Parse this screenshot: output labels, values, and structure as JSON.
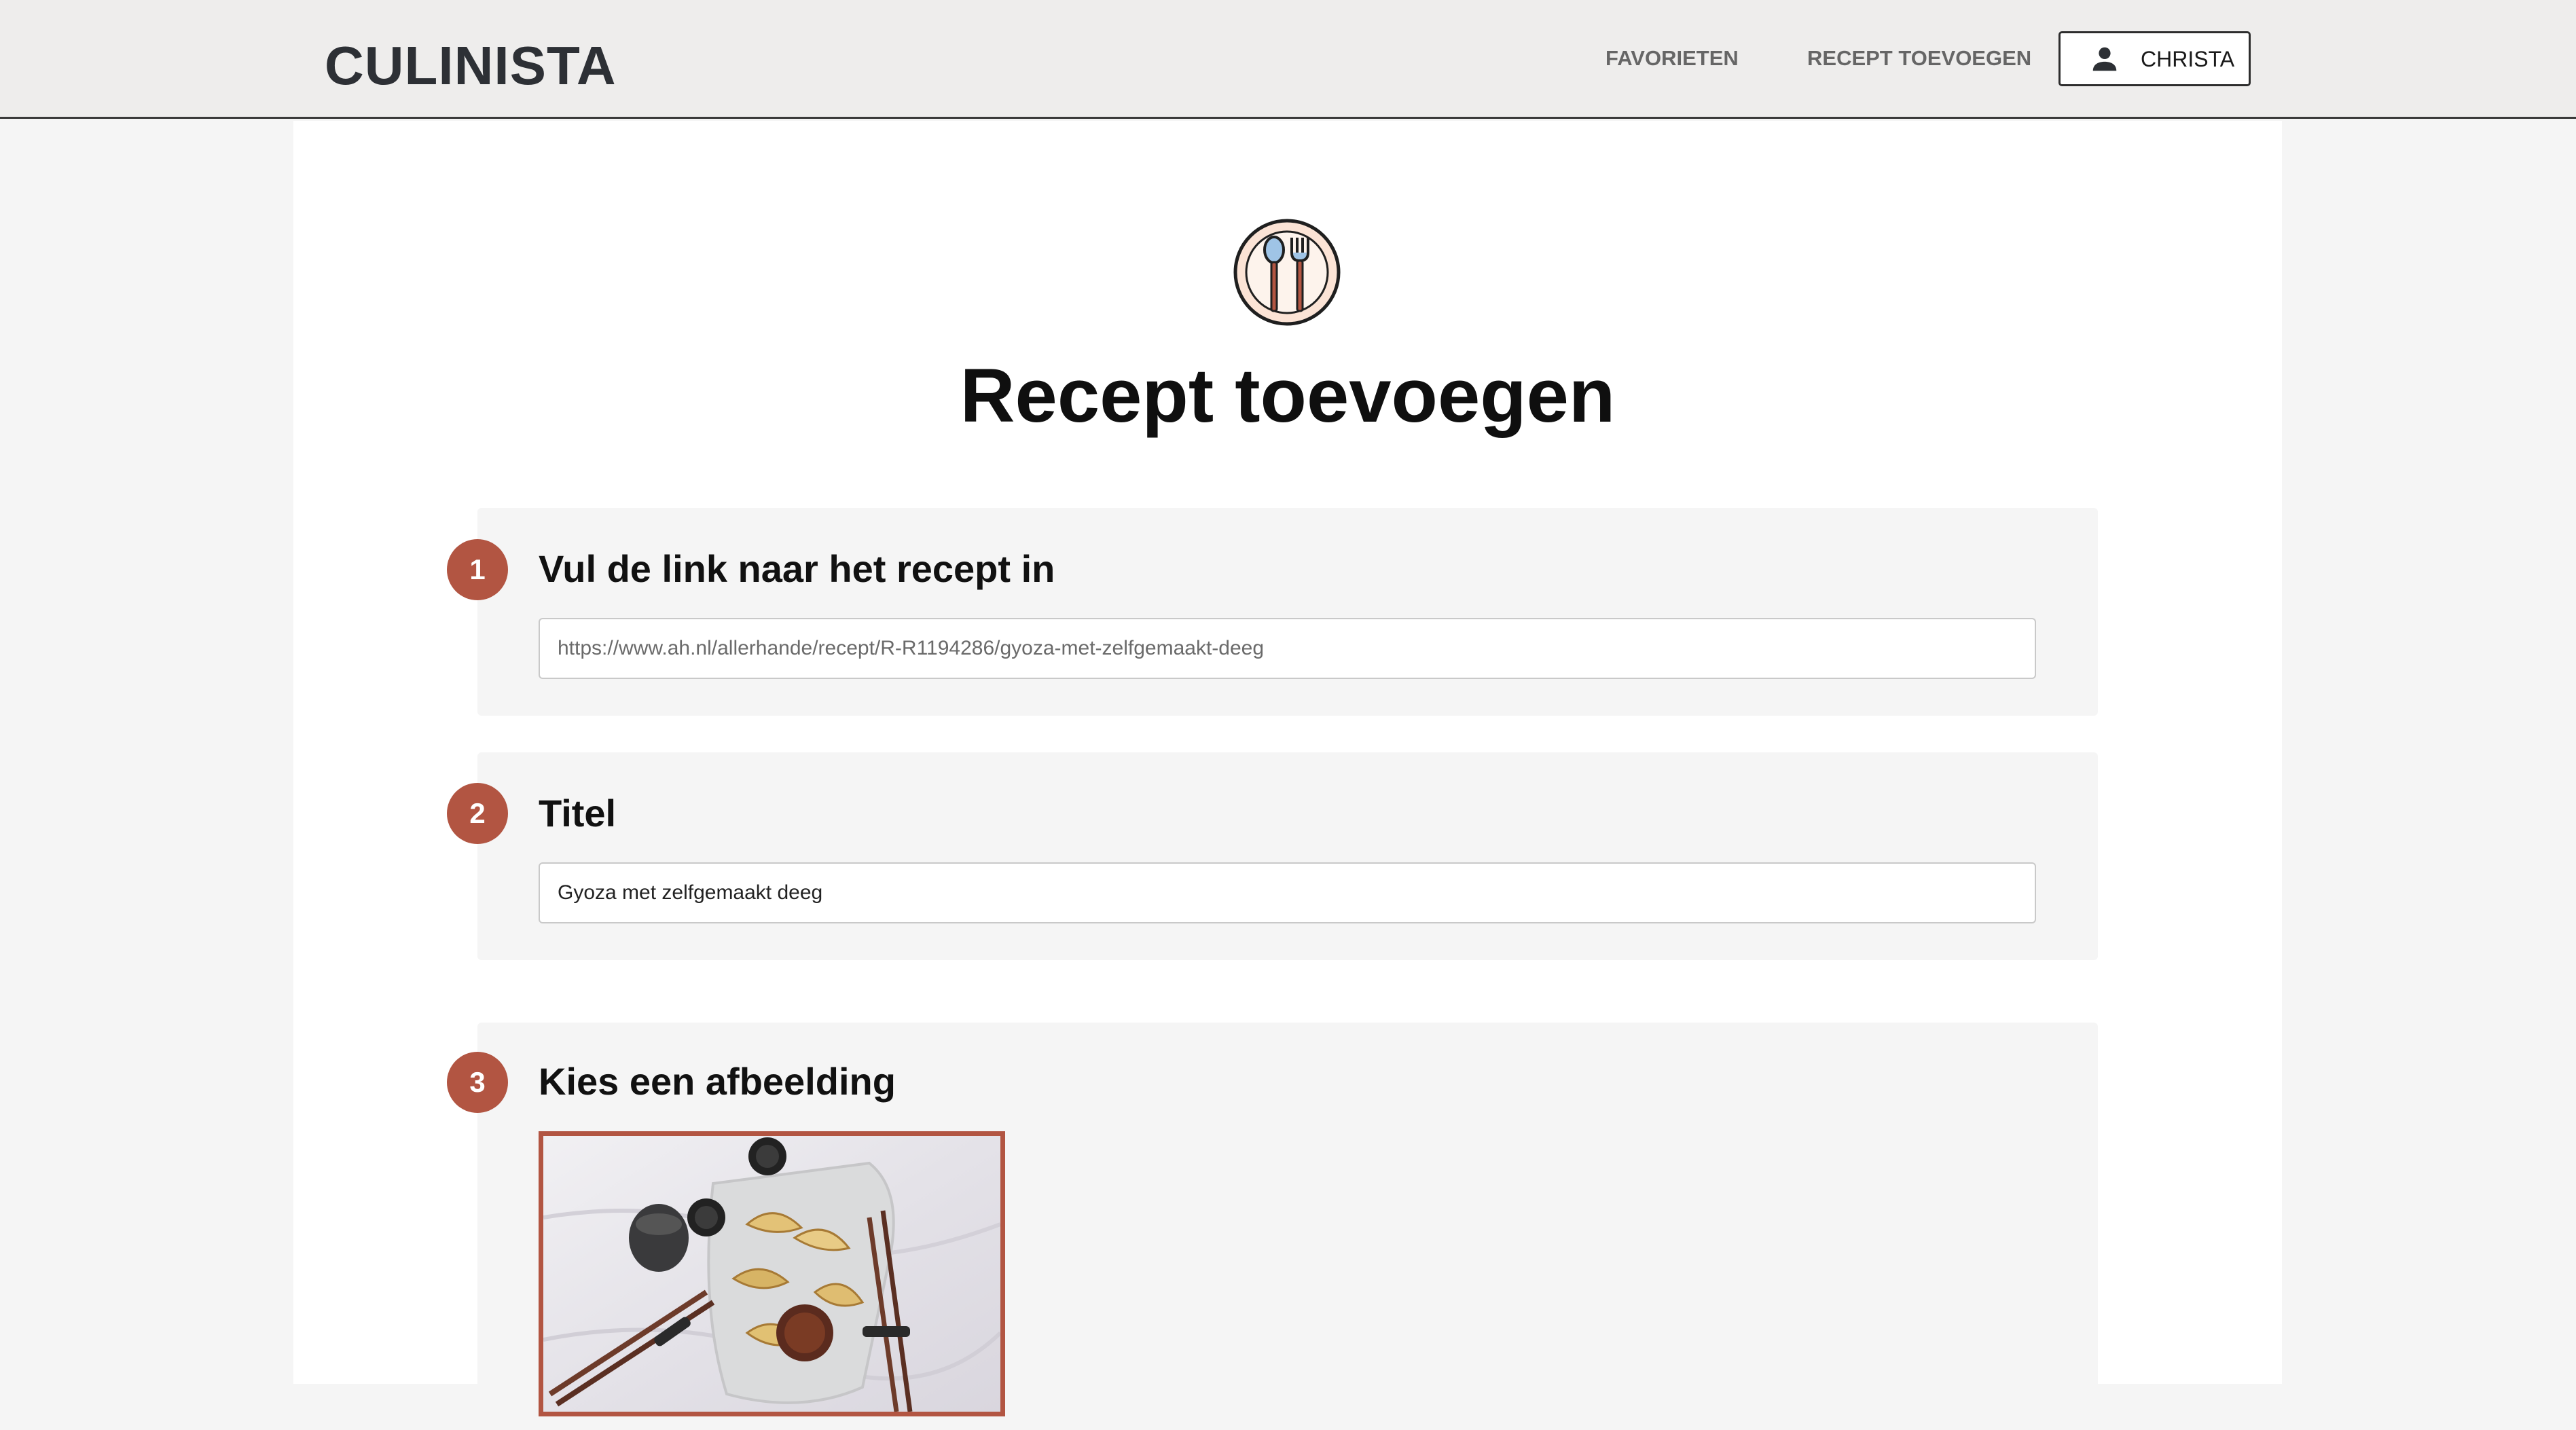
{
  "header": {
    "brand": "CULINISTA",
    "nav": {
      "favorites_label": "FAVORIETEN",
      "add_recipe_label": "RECEPT TOEVOEGEN"
    },
    "user": {
      "icon": "person-icon",
      "name": "CHRISTA"
    }
  },
  "main": {
    "icon": "plate-spoon-fork-icon",
    "title": "Recept toevoegen",
    "steps": [
      {
        "number": "1",
        "heading": "Vul de link naar het recept in",
        "input_value": "https://www.ah.nl/allerhande/recept/R-R1194286/gyoza-met-zelfgemaakt-deeg"
      },
      {
        "number": "2",
        "heading": "Titel",
        "input_value": "Gyoza met zelfgemaakt deeg"
      },
      {
        "number": "3",
        "heading": "Kies een afbeelding",
        "image": "gyoza-photo"
      }
    ]
  },
  "colors": {
    "accent": "#b25542",
    "header_bg": "#eeedec",
    "page_bg": "#f5f5f5",
    "card_bg": "#f5f5f5",
    "text_dark": "#111111",
    "nav_text": "#666666"
  }
}
